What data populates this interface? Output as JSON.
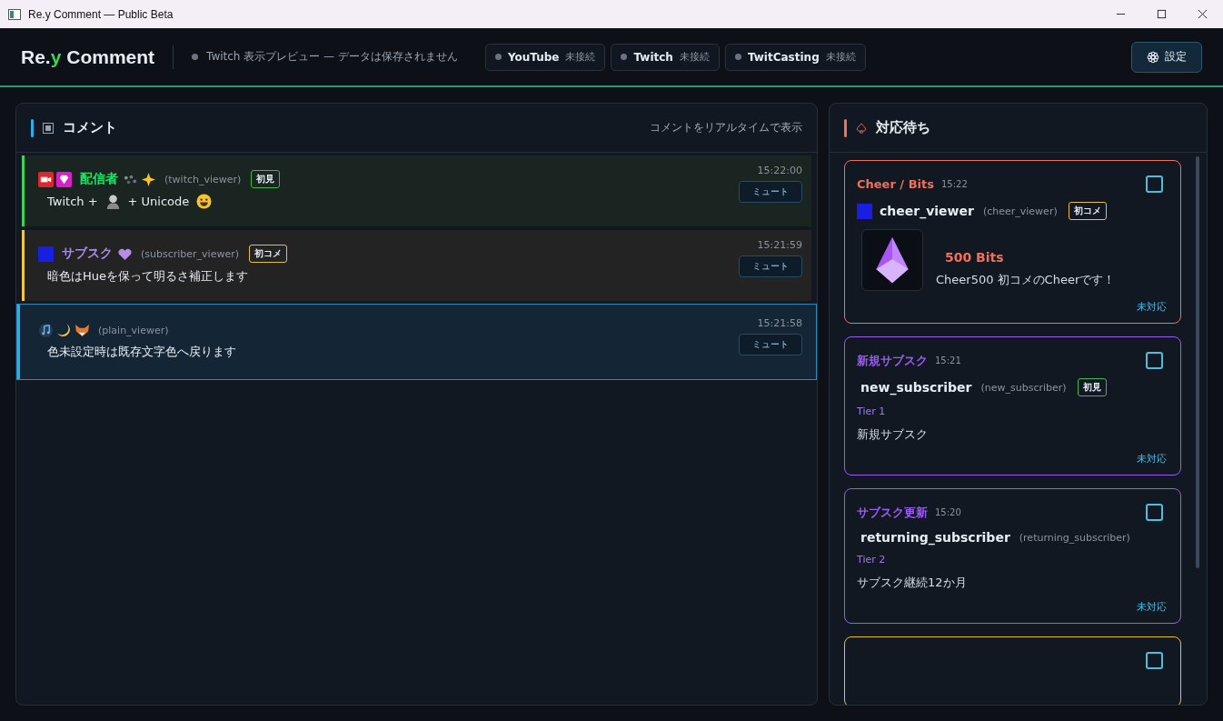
{
  "window": {
    "title": "Re.y Comment — Public Beta"
  },
  "header": {
    "logo": {
      "before": "Re.",
      "accent": "y",
      "after": " Comment"
    },
    "status": {
      "text": "Twitch 表示プレビュー — データは保存されません",
      "active": false
    },
    "connections": [
      {
        "name": "YouTube",
        "status": "未接続",
        "connected": false
      },
      {
        "name": "Twitch",
        "status": "未接続",
        "connected": false
      },
      {
        "name": "TwitCasting",
        "status": "未接続",
        "connected": false
      }
    ],
    "settings_button": "設定"
  },
  "comments_panel": {
    "title": "コメント",
    "hint": "コメントをリアルタイムで表示",
    "comments": [
      {
        "kind": "broadcaster",
        "color": "#3fd15a",
        "selected": false,
        "name_icons": [
          {
            "kind": "camera"
          },
          {
            "kind": "gem"
          }
        ],
        "name": {
          "text": "配信者",
          "color": "#22e06a"
        },
        "after_icons": [
          {
            "kind": "dots"
          },
          {
            "kind": "sparkle"
          }
        ],
        "login": "(twitch_viewer)",
        "badge": {
          "text": "初見",
          "color": "#3fb950"
        },
        "parts": [
          {
            "kind": "text",
            "text": "Twitch +"
          },
          {
            "kind": "emote"
          },
          {
            "kind": "text",
            "text": "+ Unicode"
          },
          {
            "kind": "smiley"
          }
        ],
        "time": "15:22:00",
        "action": "ミュート"
      },
      {
        "kind": "subscriber",
        "color": "#f2c744",
        "selected": false,
        "name_icons": [
          {
            "kind": "square"
          }
        ],
        "name": {
          "text": "サブスク",
          "color": "#a08ee0"
        },
        "after_icons": [
          {
            "kind": "heart"
          }
        ],
        "login": "(subscriber_viewer)",
        "badge": {
          "text": "初コメ",
          "color": "#e3c04a"
        },
        "parts": [
          {
            "kind": "text",
            "text": "暗色はHueを保って明るさ補正します"
          }
        ],
        "time": "15:21:59",
        "action": "ミュート"
      },
      {
        "kind": "plain",
        "color": "#2ab0e8",
        "selected": true,
        "name_icons": [
          {
            "kind": "note"
          },
          {
            "kind": "moon"
          },
          {
            "kind": "fox"
          }
        ],
        "login": "(plain_viewer)",
        "parts": [
          {
            "kind": "text",
            "text": "色未設定時は既存文字色へ戻ります"
          }
        ],
        "time": "15:21:58",
        "action": "ミュート"
      }
    ]
  },
  "pending_panel": {
    "title": "対応待ち",
    "cards": [
      {
        "kind": "cheer",
        "color": "#f0705c",
        "title": "Cheer / Bits",
        "time": "15:22",
        "checked": false,
        "user_icon": true,
        "user": "cheer_viewer",
        "login": "(cheer_viewer)",
        "badge": {
          "text": "初コメ",
          "color": "#e3c04a"
        },
        "amount": "500 Bits",
        "message": "Cheer500 初コメのCheerです！",
        "status": "未対応"
      },
      {
        "kind": "sub",
        "color": "#9a5cf0",
        "title": "新規サブスク",
        "time": "15:21",
        "checked": false,
        "user_icon": false,
        "user": "new_subscriber",
        "login": "(new_subscriber)",
        "badge": {
          "text": "初見",
          "color": "#3fb950"
        },
        "tier": "Tier 1",
        "message": "新規サブスク",
        "status": "未対応"
      },
      {
        "kind": "sub",
        "color": "#9a5cf0",
        "title": "サブスク更新",
        "time": "15:20",
        "checked": false,
        "user_icon": false,
        "user": "returning_subscriber",
        "login": "(returning_subscriber)",
        "tier": "Tier 2",
        "message": "サブスク継続12か月",
        "status": "未対応"
      },
      {
        "kind": "gift",
        "color": "#e8c040",
        "checked": false
      }
    ]
  }
}
